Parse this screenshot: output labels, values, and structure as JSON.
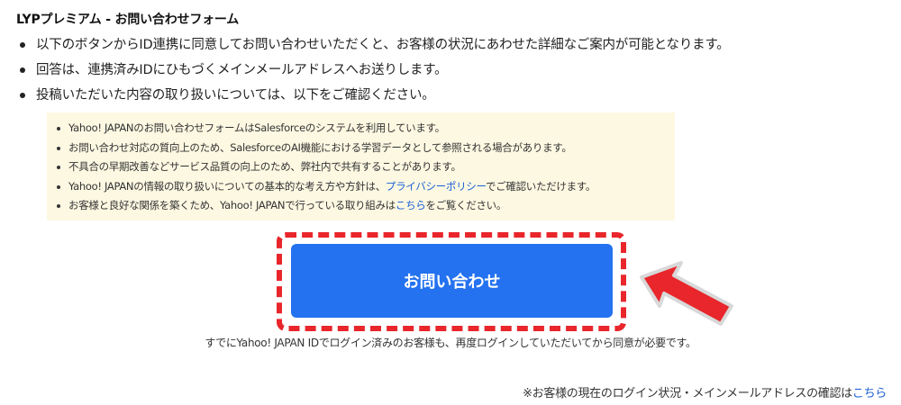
{
  "title": "LYPプレミアム - お問い合わせフォーム",
  "main_list": [
    "以下のボタンからID連携に同意してお問い合わせいただくと、お客様の状況にあわせた詳細なご案内が可能となります。",
    "回答は、連携済みIDにひもづくメインメールアドレスへお送りします。",
    "投稿いただいた内容の取り扱いについては、以下をご確認ください。"
  ],
  "notice": {
    "items": [
      {
        "text": "Yahoo! JAPANのお問い合わせフォームはSalesforceのシステムを利用しています。"
      },
      {
        "text": "お問い合わせ対応の質向上のため、SalesforceのAI機能における学習データとして参照される場合があります。"
      },
      {
        "text": "不具合の早期改善などサービス品質の向上のため、弊社内で共有することがあります。"
      },
      {
        "before": "Yahoo! JAPANの情報の取り扱いについての基本的な考え方や方針は、",
        "link": "プライバシーポリシー",
        "after": "でご確認いただけます。"
      },
      {
        "before": "お客様と良好な関係を築くため、Yahoo! JAPANで行っている取り組みは",
        "link": "こちら",
        "after": "をご覧ください。"
      }
    ]
  },
  "cta": {
    "label": "お問い合わせ"
  },
  "sub_note": "すでにYahoo! JAPAN IDでログイン済みのお客様も、再度ログインしていただいてから同意が必要です。",
  "bottom_note": {
    "text": "※お客様の現在のログイン状況・メインメールアドレスの確認は",
    "link": "こちら"
  },
  "colors": {
    "accent": "#2472f0",
    "highlight": "#e8262b",
    "notice_bg": "#fdf8e2",
    "link": "#1a5fd6"
  },
  "icons": {
    "pointer": "arrow-pointer-icon"
  }
}
